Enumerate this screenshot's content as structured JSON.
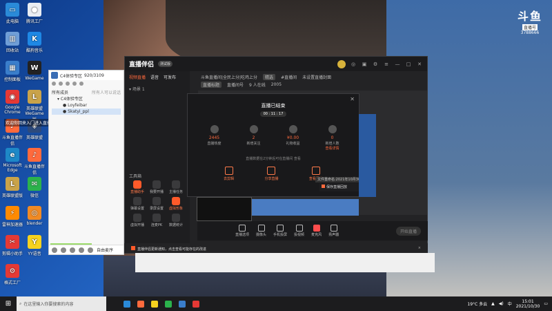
{
  "desktop": {
    "icons": [
      {
        "label": "此电脑",
        "color": "#2a8ad8",
        "glyph": "▭"
      },
      {
        "label": "腾讯工厂",
        "color": "#e9edf3",
        "glyph": "●"
      },
      {
        "label": "回收站",
        "color": "#6f9ed7",
        "glyph": "▥"
      },
      {
        "label": "酷狗音乐",
        "color": "#1e88e5",
        "glyph": "K"
      },
      {
        "label": "控制面板",
        "color": "#3a7ecb",
        "glyph": "▦"
      },
      {
        "label": "WeGame",
        "color": "#222",
        "glyph": "W"
      },
      {
        "label": "Google Chrome",
        "color": "#e53935",
        "glyph": "◉"
      },
      {
        "label": "英雄联盟 WeGame版",
        "color": "#c9a34a",
        "glyph": "L"
      },
      {
        "label": "斗鱼直播伴侣",
        "color": "#ff6a3d",
        "glyph": "♪"
      },
      {
        "label": "英雄联盟",
        "color": "#2d4a7c",
        "glyph": "◈"
      },
      {
        "label": "Microsoft Edge",
        "color": "#1e88c7",
        "glyph": "e"
      },
      {
        "label": "斗鱼直播伴侣",
        "color": "#ff6a3d",
        "glyph": "♪"
      },
      {
        "label": "英雄联盟版",
        "color": "#c9a34a",
        "glyph": "L"
      },
      {
        "label": "微信",
        "color": "#2bb24c",
        "glyph": "✉"
      },
      {
        "label": "雷神加速器",
        "color": "#ff8a00",
        "glyph": "⚡"
      },
      {
        "label": "blender",
        "color": "#f08a24",
        "glyph": "◎"
      },
      {
        "label": "剪辑小助手",
        "color": "#e53935",
        "glyph": "✂"
      },
      {
        "label": "YY语音",
        "color": "#f6d21f",
        "glyph": "Y"
      },
      {
        "label": "格式工厂",
        "color": "#e53935",
        "glyph": "⚙"
      }
    ],
    "overlay_text": "欢迎你回来入门进入直播间"
  },
  "watermark": {
    "logo": "斗鱼",
    "tag": "直播号",
    "sub": "3788666"
  },
  "chat": {
    "title": "C4体验专区",
    "room": "920/3109",
    "members_label": "所有成员",
    "members_hint": "所有人可以说话",
    "group": "C4体验专区",
    "user1": "Loyfeibar",
    "user2": "Skatyi_ppl",
    "bottom_label": "自由麦序"
  },
  "app": {
    "title": "直播伴侣",
    "version": "测试版",
    "tabs": [
      "视频直播",
      "语音",
      "可发布"
    ],
    "scene": "场景 1",
    "tools_title": "工具箱",
    "tools": [
      {
        "label": "直播助手",
        "hl": true,
        "orange": true
      },
      {
        "label": "我要开播",
        "hl": false,
        "orange": false
      },
      {
        "label": "主播任务",
        "hl": false,
        "orange": false
      },
      {
        "label": "弹幕设置",
        "hl": false,
        "orange": false
      },
      {
        "label": "录屏设置",
        "hl": false,
        "orange": false
      },
      {
        "label": "虚拟形象",
        "hl": true,
        "orange": true
      },
      {
        "label": "虚拟开播",
        "hl": false,
        "orange": false
      },
      {
        "label": "连麦PK",
        "hl": false,
        "orange": false
      },
      {
        "label": "数据统计",
        "hl": false,
        "orange": false
      }
    ],
    "room_title": "斗鱼直播间|全民上分|吃鸡上分",
    "room_chip": "精选",
    "room_tag": "#直播间",
    "room_tag2": "未设置直播封面",
    "row2": [
      "直播标题",
      "直播间号",
      "9 人在线"
    ],
    "row2b": "2005",
    "ended": {
      "title": "直播已结束",
      "timer": "00 : 11 : 17",
      "stats": [
        {
          "value": "2445",
          "label": "直播热度"
        },
        {
          "value": "2",
          "label": "新增关注"
        },
        {
          "value": "¥0.00",
          "label": "礼物收益"
        },
        {
          "value": "0",
          "label": "新增人数",
          "link": "查看详情"
        }
      ],
      "note": "直播数据在2分钟后可在直播间  查看",
      "actions": [
        "去剪辑",
        "分享直播",
        "查看回放"
      ]
    },
    "rename_text": "文件重命名:2021年10月30日直播...",
    "save_text": "保存直播回放",
    "bottom_tools": [
      {
        "label": "直播选项",
        "red": false
      },
      {
        "label": "摄像头",
        "red": false
      },
      {
        "label": "手机投屏",
        "red": false
      },
      {
        "label": "投视频",
        "red": false
      },
      {
        "label": "麦克风",
        "red": true
      },
      {
        "label": "扬声器",
        "red": false
      }
    ],
    "start_button": "开始直播",
    "sys_msg": "直播伴侣更新通知，点击查看可能存在的改进",
    "sys_close": "×"
  },
  "taskbar": {
    "search_placeholder": "在这里输入你要搜索的内容",
    "weather": "19°C 多云",
    "time": "15:01",
    "date": "2021/10/30",
    "apps": [
      "#2a8ad8",
      "#ff6a3d",
      "#f6d21f",
      "#2bb24c",
      "#3a7ecb",
      "#e53935"
    ]
  }
}
